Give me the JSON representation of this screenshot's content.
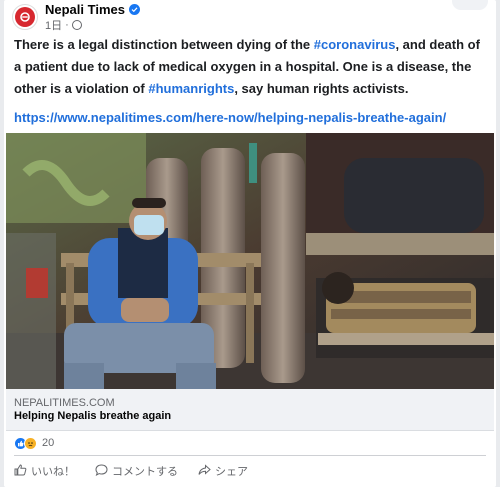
{
  "post": {
    "page_name": "Nepali Times",
    "time": "1日",
    "separator": "·",
    "text_before_1": "There is a legal distinction between dying of the ",
    "hashtag_1": "#coronavirus",
    "text_middle": ", and death of a patient due to lack of medical oxygen in a hospital. One is a disease, the other is a violation of ",
    "hashtag_2": "#humanrights",
    "text_after": ", say human rights activists.",
    "link": "https://www.nepalitimes.com/here-now/helping-nepalis-breathe-again/"
  },
  "link_preview": {
    "domain": "NEPALITIMES.COM",
    "title": "Helping Nepalis breathe again"
  },
  "reactions": {
    "count": "20",
    "icons": [
      "like-icon",
      "sad-icon"
    ]
  },
  "actions": {
    "like": "いいね！",
    "comment": "コメントする",
    "share": "シェア"
  },
  "colors": {
    "brand_red": "#d7282f",
    "link_blue": "#216fdb",
    "verified_blue": "#1877f2"
  }
}
